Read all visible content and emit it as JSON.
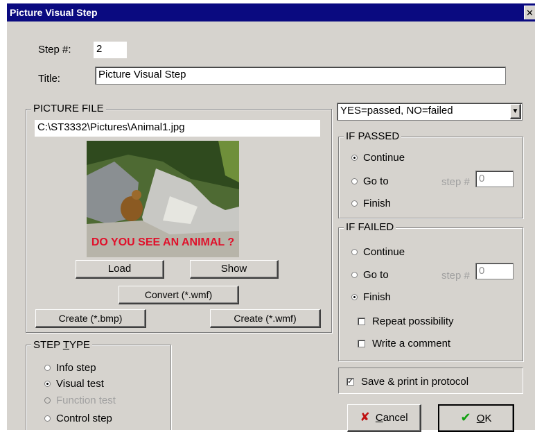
{
  "window": {
    "title": "Picture Visual Step",
    "close_glyph": "✕"
  },
  "step": {
    "label": "Step #:",
    "value": "2"
  },
  "title_field": {
    "label": "Title:",
    "value": "Picture Visual Step"
  },
  "picture_file": {
    "group_label": "PICTURE FILE",
    "path": "C:\\ST3332\\Pictures\\Animal1.jpg",
    "overlay_text": "DO YOU SEE AN ANIMAL ?",
    "load": "Load",
    "show": "Show",
    "convert": "Convert (*.wmf)",
    "create_bmp": "Create (*.bmp)",
    "create_wmf": "Create (*.wmf)"
  },
  "answer_select": {
    "value": "YES=passed, NO=failed"
  },
  "if_passed": {
    "group_label": "IF PASSED",
    "continue": "Continue",
    "goto": "Go to",
    "finish": "Finish",
    "step_label": "step #",
    "step_value": "0",
    "selected": "continue"
  },
  "if_failed": {
    "group_label": "IF FAILED",
    "continue": "Continue",
    "goto": "Go to",
    "finish": "Finish",
    "step_label": "step #",
    "step_value": "0",
    "repeat": "Repeat possibility",
    "comment": "Write a comment",
    "selected": "finish"
  },
  "step_type": {
    "group_label": "STEP TYPE",
    "info": "Info step",
    "visual": "Visual test",
    "function": "Function test",
    "control": "Control step",
    "selected": "visual"
  },
  "save_print": {
    "label": "Save & print in protocol",
    "checked": true
  },
  "buttons": {
    "cancel": "Cancel",
    "ok": "OK"
  },
  "colors": {
    "titlebar": "#0a0a80",
    "face": "#d6d3ce",
    "overlay_text": "#e0102a",
    "cancel_icon": "#c01010",
    "ok_icon": "#10a010"
  }
}
